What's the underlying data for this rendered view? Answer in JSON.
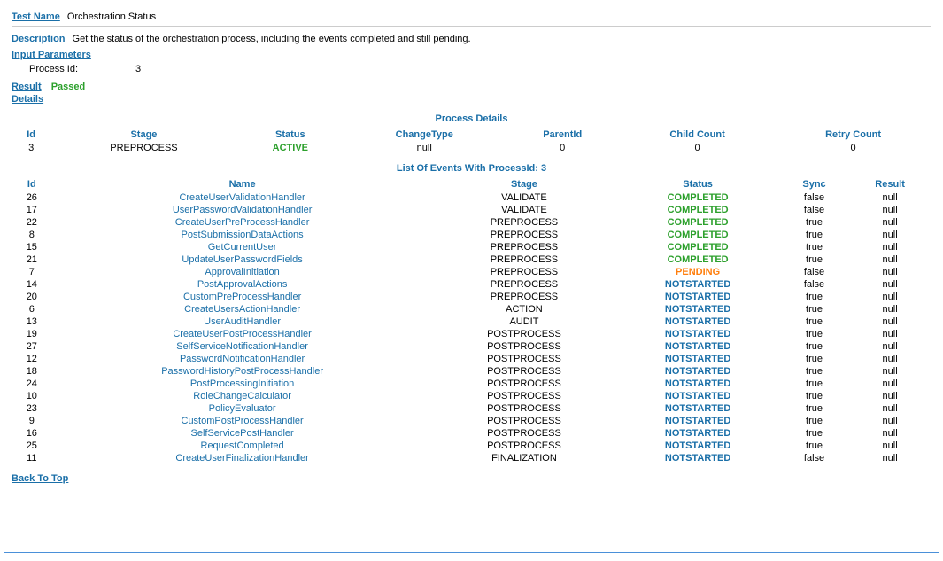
{
  "header": {
    "test_name_label": "Test Name",
    "test_name_value": "Orchestration Status",
    "description_label": "Description",
    "description_value": "Get the status of the orchestration process, including the events completed and still pending."
  },
  "input_parameters": {
    "label": "Input Parameters",
    "params": [
      {
        "key": "Process Id:",
        "value": "3"
      }
    ]
  },
  "result": {
    "label": "Result",
    "value": "Passed"
  },
  "details_label": "Details",
  "process_details": {
    "title": "Process Details",
    "columns": [
      "Id",
      "Stage",
      "Status",
      "ChangeType",
      "ParentId",
      "Child Count",
      "Retry Count"
    ],
    "rows": [
      {
        "id": "3",
        "stage": "PREPROCESS",
        "status": "ACTIVE",
        "change_type": "null",
        "parent_id": "0",
        "child_count": "0",
        "retry_count": "0"
      }
    ]
  },
  "events": {
    "title": "List Of Events With ProcessId: 3",
    "columns": [
      "Id",
      "Name",
      "Stage",
      "Status",
      "Sync",
      "Result"
    ],
    "rows": [
      {
        "id": "26",
        "name": "CreateUserValidationHandler",
        "stage": "VALIDATE",
        "status": "COMPLETED",
        "sync": "false",
        "result": "null"
      },
      {
        "id": "17",
        "name": "UserPasswordValidationHandler",
        "stage": "VALIDATE",
        "status": "COMPLETED",
        "sync": "false",
        "result": "null"
      },
      {
        "id": "22",
        "name": "CreateUserPreProcessHandler",
        "stage": "PREPROCESS",
        "status": "COMPLETED",
        "sync": "true",
        "result": "null"
      },
      {
        "id": "8",
        "name": "PostSubmissionDataActions",
        "stage": "PREPROCESS",
        "status": "COMPLETED",
        "sync": "true",
        "result": "null"
      },
      {
        "id": "15",
        "name": "GetCurrentUser",
        "stage": "PREPROCESS",
        "status": "COMPLETED",
        "sync": "true",
        "result": "null"
      },
      {
        "id": "21",
        "name": "UpdateUserPasswordFields",
        "stage": "PREPROCESS",
        "status": "COMPLETED",
        "sync": "true",
        "result": "null"
      },
      {
        "id": "7",
        "name": "ApprovalInitiation",
        "stage": "PREPROCESS",
        "status": "PENDING",
        "sync": "false",
        "result": "null"
      },
      {
        "id": "14",
        "name": "PostApprovalActions",
        "stage": "PREPROCESS",
        "status": "NOTSTARTED",
        "sync": "false",
        "result": "null"
      },
      {
        "id": "20",
        "name": "CustomPreProcessHandler",
        "stage": "PREPROCESS",
        "status": "NOTSTARTED",
        "sync": "true",
        "result": "null"
      },
      {
        "id": "6",
        "name": "CreateUsersActionHandler",
        "stage": "ACTION",
        "status": "NOTSTARTED",
        "sync": "true",
        "result": "null"
      },
      {
        "id": "13",
        "name": "UserAuditHandler",
        "stage": "AUDIT",
        "status": "NOTSTARTED",
        "sync": "true",
        "result": "null"
      },
      {
        "id": "19",
        "name": "CreateUserPostProcessHandler",
        "stage": "POSTPROCESS",
        "status": "NOTSTARTED",
        "sync": "true",
        "result": "null"
      },
      {
        "id": "27",
        "name": "SelfServiceNotificationHandler",
        "stage": "POSTPROCESS",
        "status": "NOTSTARTED",
        "sync": "true",
        "result": "null"
      },
      {
        "id": "12",
        "name": "PasswordNotificationHandler",
        "stage": "POSTPROCESS",
        "status": "NOTSTARTED",
        "sync": "true",
        "result": "null"
      },
      {
        "id": "18",
        "name": "PasswordHistoryPostProcessHandler",
        "stage": "POSTPROCESS",
        "status": "NOTSTARTED",
        "sync": "true",
        "result": "null"
      },
      {
        "id": "24",
        "name": "PostProcessingInitiation",
        "stage": "POSTPROCESS",
        "status": "NOTSTARTED",
        "sync": "true",
        "result": "null"
      },
      {
        "id": "10",
        "name": "RoleChangeCalculator",
        "stage": "POSTPROCESS",
        "status": "NOTSTARTED",
        "sync": "true",
        "result": "null"
      },
      {
        "id": "23",
        "name": "PolicyEvaluator",
        "stage": "POSTPROCESS",
        "status": "NOTSTARTED",
        "sync": "true",
        "result": "null"
      },
      {
        "id": "9",
        "name": "CustomPostProcessHandler",
        "stage": "POSTPROCESS",
        "status": "NOTSTARTED",
        "sync": "true",
        "result": "null"
      },
      {
        "id": "16",
        "name": "SelfServicePostHandler",
        "stage": "POSTPROCESS",
        "status": "NOTSTARTED",
        "sync": "true",
        "result": "null"
      },
      {
        "id": "25",
        "name": "RequestCompleted",
        "stage": "POSTPROCESS",
        "status": "NOTSTARTED",
        "sync": "true",
        "result": "null"
      },
      {
        "id": "11",
        "name": "CreateUserFinalizationHandler",
        "stage": "FINALIZATION",
        "status": "NOTSTARTED",
        "sync": "false",
        "result": "null"
      }
    ]
  },
  "back_to_top": "Back To Top"
}
